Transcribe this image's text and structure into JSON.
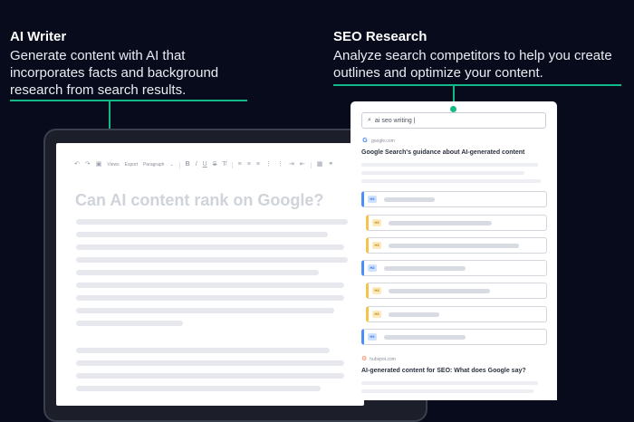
{
  "writer": {
    "title": "AI Writer",
    "description": "Generate content with AI that incorporates facts and background research from search results."
  },
  "seo": {
    "title": "SEO Research",
    "description": "Analyze search competitors to help you create outlines and optimize your content."
  },
  "editor": {
    "toolbar": {
      "undo_icon": "undo-icon",
      "redo_icon": "redo-icon",
      "save_icon": "save-icon",
      "views_label": "Views",
      "export_label": "Export",
      "style_label": "Paragraph"
    },
    "document_title": "Can AI content rank on Google?"
  },
  "panel": {
    "search_value": "ai seo writing |",
    "results": [
      {
        "source": "google.com",
        "title": "Google Search's guidance about AI-generated content"
      },
      {
        "source": "hubspot.com",
        "title": "AI-generated content for SEO: What does Google say?"
      }
    ],
    "outline": [
      {
        "level": "H2",
        "fill": 0.45
      },
      {
        "level": "H3",
        "fill": 0.75
      },
      {
        "level": "H3",
        "fill": 0.85
      },
      {
        "level": "H2",
        "fill": 0.55
      },
      {
        "level": "H3",
        "fill": 0.7
      },
      {
        "level": "H3",
        "fill": 0.45
      },
      {
        "level": "H2",
        "fill": 0.55
      }
    ]
  },
  "colors": {
    "background": "#070b1c",
    "accent": "#12b886",
    "h2": "#4a8ff7",
    "h3": "#f5c34a"
  }
}
